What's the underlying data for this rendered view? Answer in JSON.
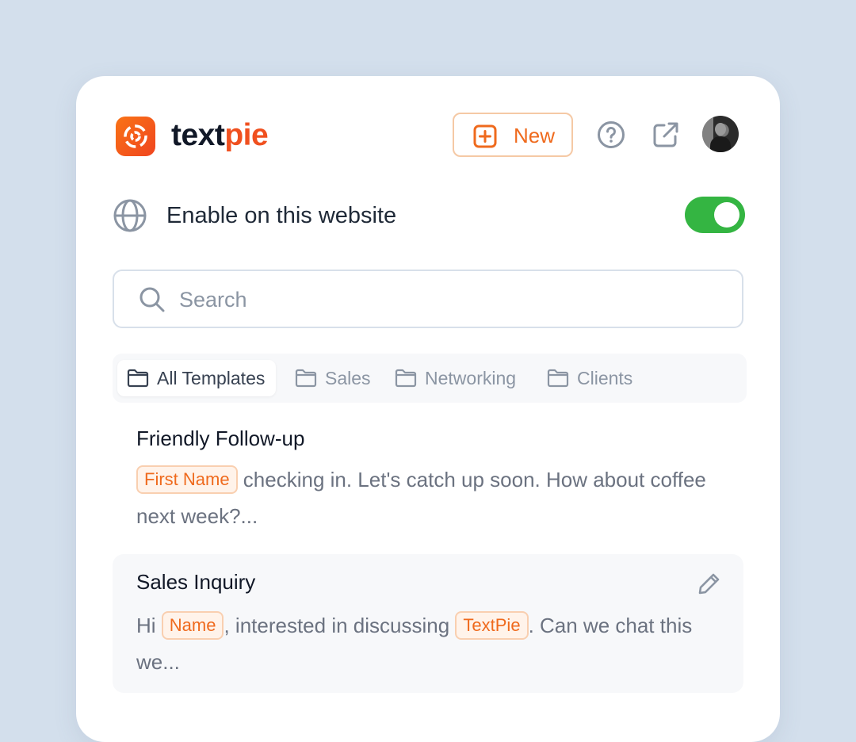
{
  "brand": {
    "part1": "text",
    "part2": "pie",
    "logo_icon": "swirl-logo-icon"
  },
  "header": {
    "new_label": "New",
    "new_icon": "plus-square-icon",
    "help_icon": "help-circle-icon",
    "external_icon": "external-link-icon",
    "avatar": "user-avatar"
  },
  "enable": {
    "label": "Enable on this website",
    "icon": "globe-icon",
    "enabled": true
  },
  "search": {
    "placeholder": "Search",
    "value": "",
    "icon": "search-icon"
  },
  "tabs": [
    {
      "label": "All Templates",
      "active": true,
      "icon": "folder-icon"
    },
    {
      "label": "Sales",
      "active": false,
      "icon": "folder-icon"
    },
    {
      "label": "Networking",
      "active": false,
      "icon": "folder-icon"
    },
    {
      "label": "Clients",
      "active": false,
      "icon": "folder-icon"
    }
  ],
  "templates": [
    {
      "title": "Friendly Follow-up",
      "chip1": "First Name",
      "text1": " checking in. Let's catch up soon. How about coffee next week?..."
    },
    {
      "title": "Sales Inquiry",
      "pre": "Hi ",
      "chip1": "Name",
      "mid": ", interested in discussing ",
      "chip2": "TextPie",
      "post": ". Can we chat this we...",
      "edit_icon": "pencil-icon"
    }
  ],
  "colors": {
    "accent": "#ef6a1d",
    "toggle_on": "#34b542",
    "background": "#d3dfec"
  }
}
